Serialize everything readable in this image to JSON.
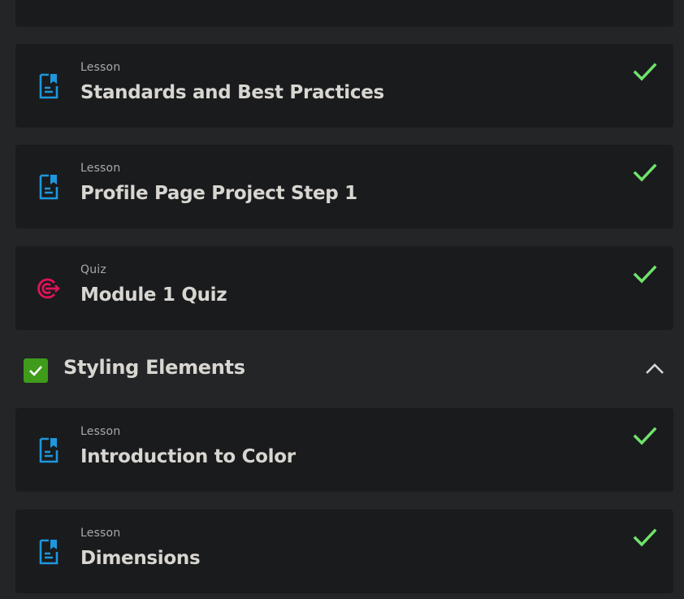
{
  "colors": {
    "background": "#232527",
    "card": "#1a1b1d",
    "lesson_icon": "#1e97dd",
    "quiz_icon": "#e3115c",
    "check": "#6fe36a",
    "section_check_box": "#3f9b1a",
    "title_text": "#d8d6d1",
    "type_text": "#a9a9ad"
  },
  "items_before": [
    {
      "type": "Lesson",
      "title": "Standards and Best Practices",
      "icon": "lesson-document-icon",
      "completed": true
    },
    {
      "type": "Lesson",
      "title": "Profile Page Project Step 1",
      "icon": "lesson-document-icon",
      "completed": true
    },
    {
      "type": "Quiz",
      "title": "Module 1 Quiz",
      "icon": "quiz-target-icon",
      "completed": true
    }
  ],
  "section": {
    "title": "Styling Elements",
    "completed": true,
    "expanded": true,
    "icon": "chevron-up-icon"
  },
  "items_after": [
    {
      "type": "Lesson",
      "title": "Introduction to Color",
      "icon": "lesson-document-icon",
      "completed": true
    },
    {
      "type": "Lesson",
      "title": "Dimensions",
      "icon": "lesson-document-icon",
      "completed": true
    }
  ]
}
